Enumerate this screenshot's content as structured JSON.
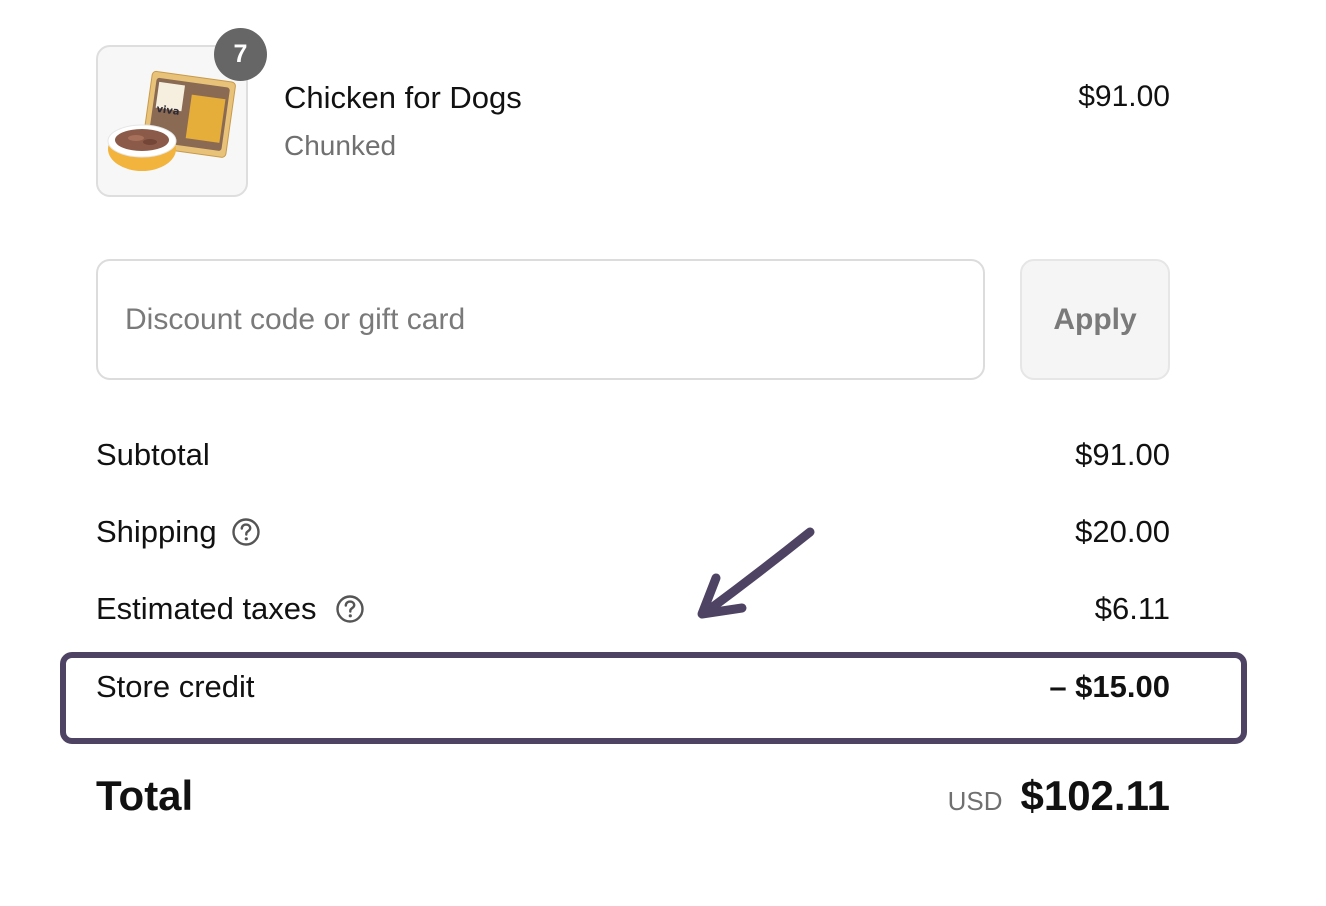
{
  "product": {
    "name": "Chicken for Dogs",
    "variant": "Chunked",
    "price": "$91.00",
    "quantity": "7",
    "thumbnail_brand_text": "viva"
  },
  "discount": {
    "placeholder": "Discount code or gift card",
    "value": "",
    "apply_label": "Apply"
  },
  "summary": {
    "subtotal_label": "Subtotal",
    "subtotal_value": "$91.00",
    "shipping_label": "Shipping",
    "shipping_value": "$20.00",
    "taxes_label": "Estimated taxes",
    "taxes_value": "$6.11",
    "store_credit_label": "Store credit",
    "store_credit_value": "– $15.00"
  },
  "total": {
    "label": "Total",
    "currency": "USD",
    "amount": "$102.11"
  },
  "colors": {
    "highlight": "#4e4363",
    "badge": "#666666"
  },
  "icons": {
    "help": "question-circle-icon",
    "annotation": "arrow-icon"
  }
}
